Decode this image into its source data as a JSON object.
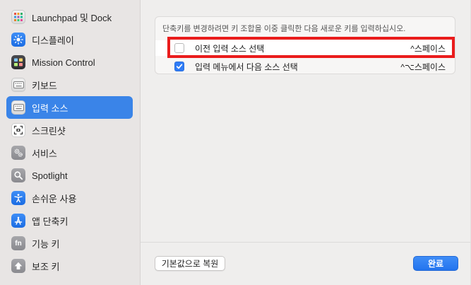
{
  "sidebar": {
    "items": [
      {
        "label": "Launchpad 및 Dock",
        "icon": "launchpad-dock-icon"
      },
      {
        "label": "디스플레이",
        "icon": "display-brightness-icon"
      },
      {
        "label": "Mission Control",
        "icon": "mission-control-icon"
      },
      {
        "label": "키보드",
        "icon": "keyboard-icon"
      },
      {
        "label": "입력 소스",
        "icon": "input-sources-icon",
        "selected": true
      },
      {
        "label": "스크린샷",
        "icon": "screenshot-icon"
      },
      {
        "label": "서비스",
        "icon": "services-gear-icon"
      },
      {
        "label": "Spotlight",
        "icon": "spotlight-search-icon"
      },
      {
        "label": "손쉬운 사용",
        "icon": "accessibility-icon"
      },
      {
        "label": "앱 단축키",
        "icon": "app-shortcuts-icon"
      },
      {
        "label": "기능 키",
        "icon": "function-keys-icon"
      },
      {
        "label": "보조 키",
        "icon": "modifier-keys-icon"
      }
    ]
  },
  "main": {
    "hint": "단축키를 변경하려면 키 조합을 이중 클릭한 다음 새로운 키를 입력하십시오.",
    "rows": [
      {
        "label": "이전 입력 소스 선택",
        "shortcut": "^스페이스",
        "checked": false
      },
      {
        "label": "입력 메뉴에서 다음 소스 선택",
        "shortcut": "^⌥스페이스",
        "checked": true
      }
    ],
    "restore_label": "기본값으로 복원",
    "done_label": "완료"
  },
  "colors": {
    "accent": "#3a84e8",
    "highlight": "#ea1c1c"
  }
}
